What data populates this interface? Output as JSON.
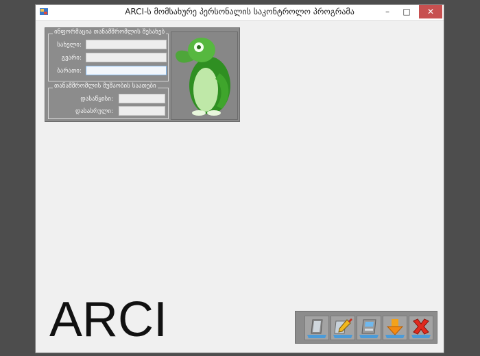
{
  "window": {
    "title": "ARCI-ს მომსახურე პერსონალის საკონტროლო პროგრამა",
    "controls": {
      "minimize": "–",
      "maximize": "□",
      "close": "✕"
    }
  },
  "employee_info": {
    "group_title": "ინფორმაცია თანამშრომლის შესახებ",
    "fields": [
      {
        "label": "სახელი:",
        "value": ""
      },
      {
        "label": "გვარი:",
        "value": ""
      },
      {
        "label": "ბარათი:",
        "value": ""
      }
    ]
  },
  "work_hours": {
    "group_title": "თანამშრომლის მუშაობის საათები",
    "fields": [
      {
        "label": "დასაწყისი:",
        "value": ""
      },
      {
        "label": "დასასრული:",
        "value": ""
      }
    ]
  },
  "logo_text": "ARCI",
  "toolbar": {
    "buttons": [
      {
        "icon": "card-scanner-icon"
      },
      {
        "icon": "edit-pencil-icon"
      },
      {
        "icon": "card-reader-icon"
      },
      {
        "icon": "download-arrow-icon"
      },
      {
        "icon": "delete-x-icon"
      }
    ]
  },
  "colors": {
    "close_button": "#c75050",
    "panel_gray": "#8c8c8c",
    "window_bg": "#f0f0f0",
    "active_field_border": "#7eb4ea"
  }
}
